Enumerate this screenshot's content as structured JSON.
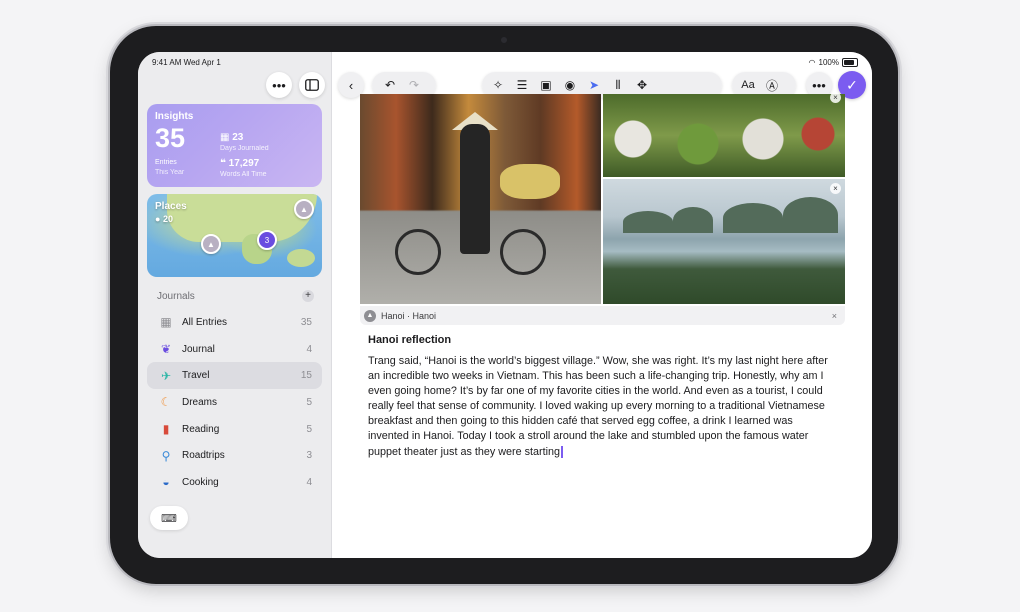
{
  "status": {
    "time": "9:41 AM  Wed Apr 1",
    "battery": "100%"
  },
  "sidebar": {
    "insights": {
      "title": "Insights",
      "entries": "35",
      "entries_label": "Entries",
      "entries_sub": "This Year",
      "days": "23",
      "days_label": "Days Journaled",
      "words": "17,297",
      "words_label": "Words All Time"
    },
    "places": {
      "title": "Places",
      "count": "20",
      "pin_cluster": "3"
    },
    "journals_header": "Journals",
    "items": [
      {
        "label": "All Entries",
        "count": "35",
        "icon": "grid-icon"
      },
      {
        "label": "Journal",
        "count": "4",
        "icon": "butterfly-icon"
      },
      {
        "label": "Travel",
        "count": "15",
        "icon": "airplane-icon"
      },
      {
        "label": "Dreams",
        "count": "5",
        "icon": "moon-icon"
      },
      {
        "label": "Reading",
        "count": "5",
        "icon": "book-icon"
      },
      {
        "label": "Roadtrips",
        "count": "3",
        "icon": "bicycle-icon"
      },
      {
        "label": "Cooking",
        "count": "4",
        "icon": "pan-icon"
      }
    ]
  },
  "main": {
    "location": "Hanoi · Hanoi",
    "entry_title": "Hanoi reflection",
    "entry_body": "Trang said, “Hanoi is the world’s biggest village.” Wow, she was right. It’s my last night here after an incredible two weeks in Vietnam. This has been such a life-changing trip. Honestly, why am I even going home? It’s by far one of my favorite cities in the world. And even as a tourist, I could really feel that sense of community. I loved waking up every morning to a traditional Vietnamese breakfast and then going to this hidden café that served egg coffee, a drink I learned was invented in Hanoi. Today I took a stroll around the lake and stumbled upon the famous water puppet theater just as they were starting",
    "toolbar": {
      "format_label": "Aa"
    }
  },
  "colors": {
    "accent": "#7b5cf0",
    "insights_bg": "#b7a6f1"
  }
}
